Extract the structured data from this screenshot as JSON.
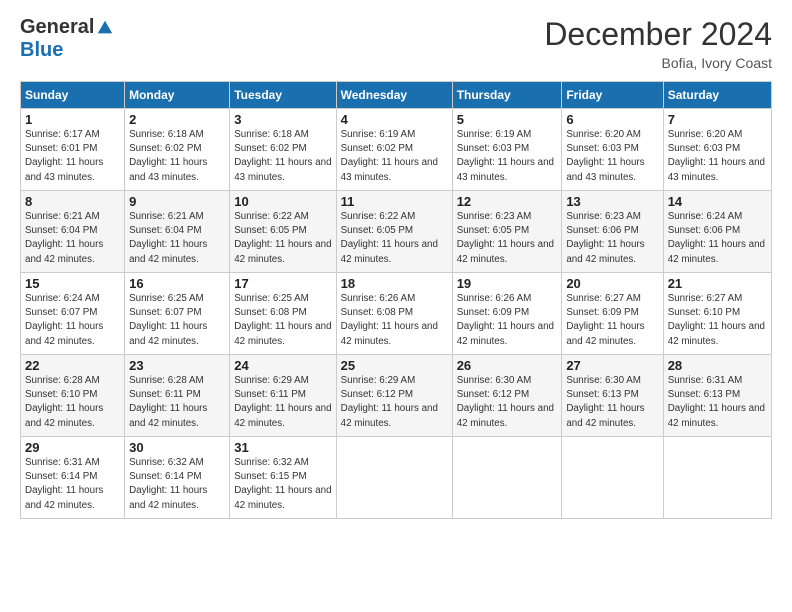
{
  "logo": {
    "general": "General",
    "blue": "Blue"
  },
  "title": "December 2024",
  "location": "Bofia, Ivory Coast",
  "headers": [
    "Sunday",
    "Monday",
    "Tuesday",
    "Wednesday",
    "Thursday",
    "Friday",
    "Saturday"
  ],
  "weeks": [
    [
      {
        "day": "1",
        "sunrise": "6:17 AM",
        "sunset": "6:01 PM",
        "daylight": "11 hours and 43 minutes."
      },
      {
        "day": "2",
        "sunrise": "6:18 AM",
        "sunset": "6:02 PM",
        "daylight": "11 hours and 43 minutes."
      },
      {
        "day": "3",
        "sunrise": "6:18 AM",
        "sunset": "6:02 PM",
        "daylight": "11 hours and 43 minutes."
      },
      {
        "day": "4",
        "sunrise": "6:19 AM",
        "sunset": "6:02 PM",
        "daylight": "11 hours and 43 minutes."
      },
      {
        "day": "5",
        "sunrise": "6:19 AM",
        "sunset": "6:03 PM",
        "daylight": "11 hours and 43 minutes."
      },
      {
        "day": "6",
        "sunrise": "6:20 AM",
        "sunset": "6:03 PM",
        "daylight": "11 hours and 43 minutes."
      },
      {
        "day": "7",
        "sunrise": "6:20 AM",
        "sunset": "6:03 PM",
        "daylight": "11 hours and 43 minutes."
      }
    ],
    [
      {
        "day": "8",
        "sunrise": "6:21 AM",
        "sunset": "6:04 PM",
        "daylight": "11 hours and 42 minutes."
      },
      {
        "day": "9",
        "sunrise": "6:21 AM",
        "sunset": "6:04 PM",
        "daylight": "11 hours and 42 minutes."
      },
      {
        "day": "10",
        "sunrise": "6:22 AM",
        "sunset": "6:05 PM",
        "daylight": "11 hours and 42 minutes."
      },
      {
        "day": "11",
        "sunrise": "6:22 AM",
        "sunset": "6:05 PM",
        "daylight": "11 hours and 42 minutes."
      },
      {
        "day": "12",
        "sunrise": "6:23 AM",
        "sunset": "6:05 PM",
        "daylight": "11 hours and 42 minutes."
      },
      {
        "day": "13",
        "sunrise": "6:23 AM",
        "sunset": "6:06 PM",
        "daylight": "11 hours and 42 minutes."
      },
      {
        "day": "14",
        "sunrise": "6:24 AM",
        "sunset": "6:06 PM",
        "daylight": "11 hours and 42 minutes."
      }
    ],
    [
      {
        "day": "15",
        "sunrise": "6:24 AM",
        "sunset": "6:07 PM",
        "daylight": "11 hours and 42 minutes."
      },
      {
        "day": "16",
        "sunrise": "6:25 AM",
        "sunset": "6:07 PM",
        "daylight": "11 hours and 42 minutes."
      },
      {
        "day": "17",
        "sunrise": "6:25 AM",
        "sunset": "6:08 PM",
        "daylight": "11 hours and 42 minutes."
      },
      {
        "day": "18",
        "sunrise": "6:26 AM",
        "sunset": "6:08 PM",
        "daylight": "11 hours and 42 minutes."
      },
      {
        "day": "19",
        "sunrise": "6:26 AM",
        "sunset": "6:09 PM",
        "daylight": "11 hours and 42 minutes."
      },
      {
        "day": "20",
        "sunrise": "6:27 AM",
        "sunset": "6:09 PM",
        "daylight": "11 hours and 42 minutes."
      },
      {
        "day": "21",
        "sunrise": "6:27 AM",
        "sunset": "6:10 PM",
        "daylight": "11 hours and 42 minutes."
      }
    ],
    [
      {
        "day": "22",
        "sunrise": "6:28 AM",
        "sunset": "6:10 PM",
        "daylight": "11 hours and 42 minutes."
      },
      {
        "day": "23",
        "sunrise": "6:28 AM",
        "sunset": "6:11 PM",
        "daylight": "11 hours and 42 minutes."
      },
      {
        "day": "24",
        "sunrise": "6:29 AM",
        "sunset": "6:11 PM",
        "daylight": "11 hours and 42 minutes."
      },
      {
        "day": "25",
        "sunrise": "6:29 AM",
        "sunset": "6:12 PM",
        "daylight": "11 hours and 42 minutes."
      },
      {
        "day": "26",
        "sunrise": "6:30 AM",
        "sunset": "6:12 PM",
        "daylight": "11 hours and 42 minutes."
      },
      {
        "day": "27",
        "sunrise": "6:30 AM",
        "sunset": "6:13 PM",
        "daylight": "11 hours and 42 minutes."
      },
      {
        "day": "28",
        "sunrise": "6:31 AM",
        "sunset": "6:13 PM",
        "daylight": "11 hours and 42 minutes."
      }
    ],
    [
      {
        "day": "29",
        "sunrise": "6:31 AM",
        "sunset": "6:14 PM",
        "daylight": "11 hours and 42 minutes."
      },
      {
        "day": "30",
        "sunrise": "6:32 AM",
        "sunset": "6:14 PM",
        "daylight": "11 hours and 42 minutes."
      },
      {
        "day": "31",
        "sunrise": "6:32 AM",
        "sunset": "6:15 PM",
        "daylight": "11 hours and 42 minutes."
      },
      null,
      null,
      null,
      null
    ]
  ]
}
